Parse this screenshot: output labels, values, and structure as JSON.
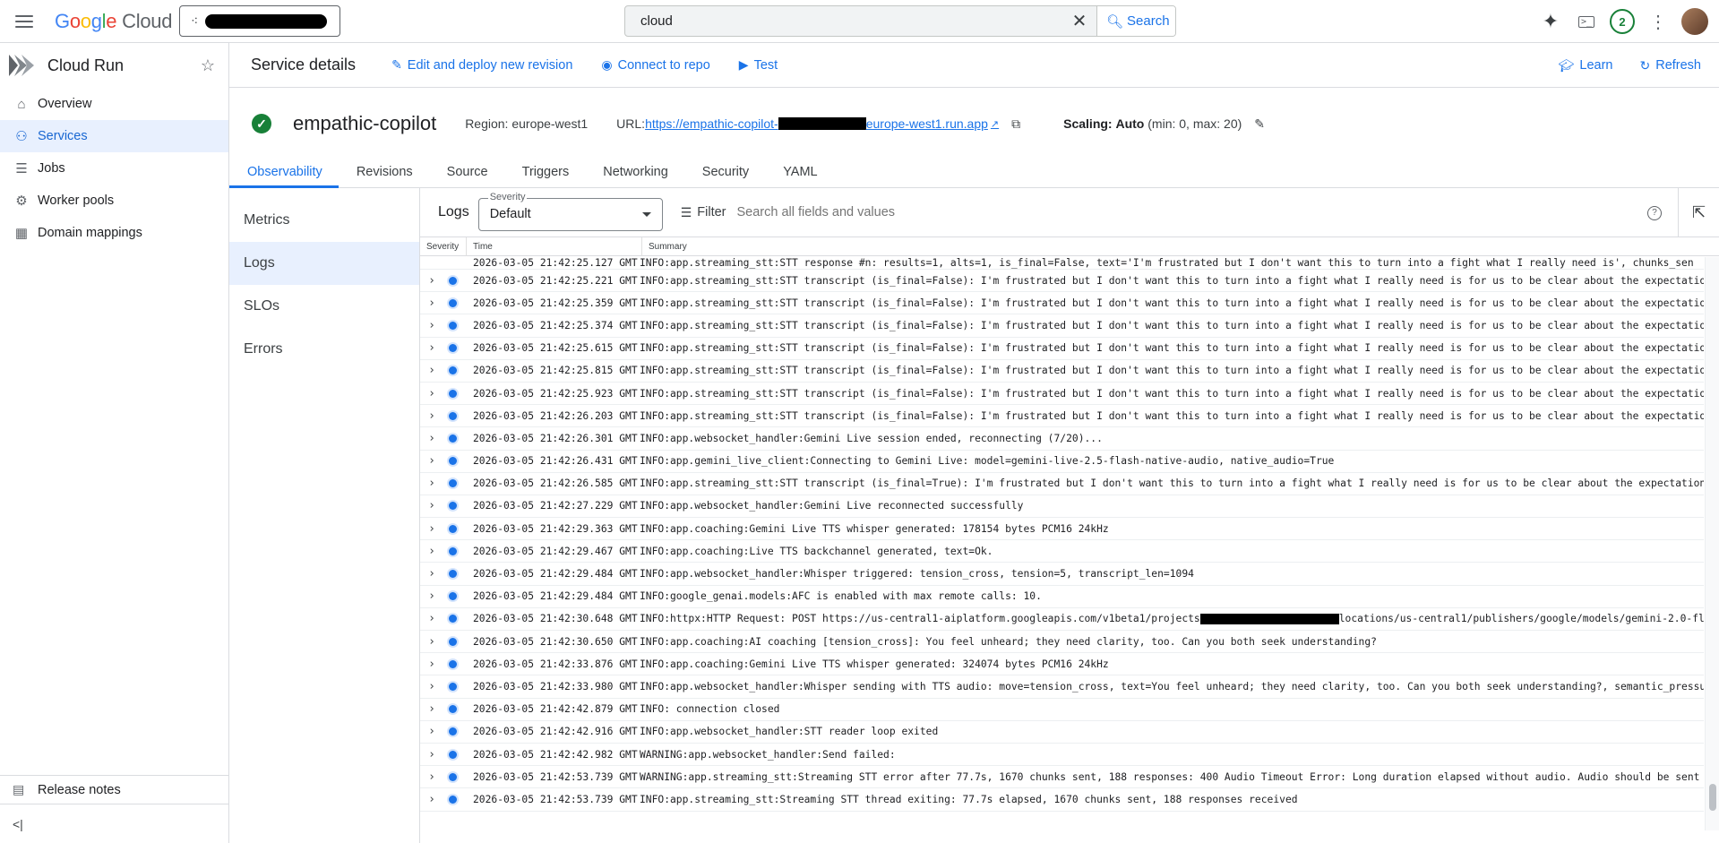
{
  "topbar": {
    "logo_google": "Google",
    "logo_cloud": "Cloud",
    "search_value": "cloud",
    "search_button": "Search",
    "notification_count": "2"
  },
  "nav": {
    "product": "Cloud Run",
    "items": [
      {
        "label": "Overview",
        "icon": "home-icon"
      },
      {
        "label": "Services",
        "icon": "services-icon"
      },
      {
        "label": "Jobs",
        "icon": "list-icon"
      },
      {
        "label": "Worker pools",
        "icon": "worker-pools-icon"
      },
      {
        "label": "Domain mappings",
        "icon": "domain-icon"
      }
    ],
    "active": "Services",
    "release_notes": "Release notes",
    "collapse": "<|"
  },
  "header": {
    "title": "Service details",
    "edit_deploy": "Edit and deploy new revision",
    "connect_repo": "Connect to repo",
    "test": "Test",
    "learn": "Learn",
    "refresh": "Refresh"
  },
  "service": {
    "name": "empathic-copilot",
    "region": "Region: europe-west1",
    "url_label": "URL:",
    "url_prefix": "https://empathic-copilot-",
    "url_suffix": "europe-west1.run.app",
    "scaling_label": "Scaling:",
    "scaling_value": "Auto",
    "scaling_detail": "(min: 0, max: 20)"
  },
  "tabs": [
    "Observability",
    "Revisions",
    "Source",
    "Triggers",
    "Networking",
    "Security",
    "YAML"
  ],
  "subnav": [
    "Metrics",
    "Logs",
    "SLOs",
    "Errors"
  ],
  "logs": {
    "title": "Logs",
    "severity_label": "Severity",
    "severity_value": "Default",
    "filter_label": "Filter",
    "filter_placeholder": "Search all fields and values",
    "columns": [
      "Severity",
      "Time",
      "Summary"
    ],
    "partial_row": {
      "time": "2026-03-05 21:42:25.127 GMT",
      "message": "INFO:app.streaming_stt:STT response #n: results=1, alts=1, is_final=False, text='I'm frustrated but I don't want this to turn into a fight what I really need is', chunks_sen"
    },
    "rows": [
      {
        "time": "2026-03-05 21:42:25.221 GMT",
        "message": "INFO:app.streaming_stt:STT transcript (is_final=False): I'm frustrated but I don't want this to turn into a fight what I really need is for us to be clear about the expectation"
      },
      {
        "time": "2026-03-05 21:42:25.359 GMT",
        "message": "INFO:app.streaming_stt:STT transcript (is_final=False): I'm frustrated but I don't want this to turn into a fight what I really need is for us to be clear about the expectation"
      },
      {
        "time": "2026-03-05 21:42:25.374 GMT",
        "message": "INFO:app.streaming_stt:STT transcript (is_final=False): I'm frustrated but I don't want this to turn into a fight what I really need is for us to be clear about the expectation"
      },
      {
        "time": "2026-03-05 21:42:25.615 GMT",
        "message": "INFO:app.streaming_stt:STT transcript (is_final=False): I'm frustrated but I don't want this to turn into a fight what I really need is for us to be clear about the expectation"
      },
      {
        "time": "2026-03-05 21:42:25.815 GMT",
        "message": "INFO:app.streaming_stt:STT transcript (is_final=False): I'm frustrated but I don't want this to turn into a fight what I really need is for us to be clear about the expectation"
      },
      {
        "time": "2026-03-05 21:42:25.923 GMT",
        "message": "INFO:app.streaming_stt:STT transcript (is_final=False): I'm frustrated but I don't want this to turn into a fight what I really need is for us to be clear about the expectation"
      },
      {
        "time": "2026-03-05 21:42:26.203 GMT",
        "message": "INFO:app.streaming_stt:STT transcript (is_final=False): I'm frustrated but I don't want this to turn into a fight what I really need is for us to be clear about the expectation"
      },
      {
        "time": "2026-03-05 21:42:26.301 GMT",
        "message": "INFO:app.websocket_handler:Gemini Live session ended, reconnecting (7/20)..."
      },
      {
        "time": "2026-03-05 21:42:26.431 GMT",
        "message": "INFO:app.gemini_live_client:Connecting to Gemini Live: model=gemini-live-2.5-flash-native-audio, native_audio=True"
      },
      {
        "time": "2026-03-05 21:42:26.585 GMT",
        "message": "INFO:app.streaming_stt:STT transcript (is_final=True): I'm frustrated but I don't want this to turn into a fight what I really need is for us to be clear about the expectation"
      },
      {
        "time": "2026-03-05 21:42:27.229 GMT",
        "message": "INFO:app.websocket_handler:Gemini Live reconnected successfully"
      },
      {
        "time": "2026-03-05 21:42:29.363 GMT",
        "message": "INFO:app.coaching:Gemini Live TTS whisper generated: 178154 bytes PCM16 24kHz"
      },
      {
        "time": "2026-03-05 21:42:29.467 GMT",
        "message": "INFO:app.coaching:Live TTS backchannel generated, text=Ok."
      },
      {
        "time": "2026-03-05 21:42:29.484 GMT",
        "message": "INFO:app.websocket_handler:Whisper triggered: tension_cross, tension=5, transcript_len=1094"
      },
      {
        "time": "2026-03-05 21:42:29.484 GMT",
        "message": "INFO:google_genai.models:AFC is enabled with max remote calls: 10."
      },
      {
        "time": "2026-03-05 21:42:30.648 GMT",
        "message": "INFO:httpx:HTTP Request: POST https://us-central1-aiplatform.googleapis.com/v1beta1/projects",
        "message_after": "locations/us-central1/publishers/google/models/gemini-2.0-fl…",
        "redacted": true
      },
      {
        "time": "2026-03-05 21:42:30.650 GMT",
        "message": "INFO:app.coaching:AI coaching [tension_cross]: You feel unheard; they need clarity, too. Can you both seek understanding?"
      },
      {
        "time": "2026-03-05 21:42:33.876 GMT",
        "message": "INFO:app.coaching:Gemini Live TTS whisper generated: 324074 bytes PCM16 24kHz"
      },
      {
        "time": "2026-03-05 21:42:33.980 GMT",
        "message": "INFO:app.websocket_handler:Whisper sending with TTS audio: move=tension_cross, text=You feel unheard; they need clarity, too. Can you both seek understanding?, semantic_pressur…"
      },
      {
        "time": "2026-03-05 21:42:42.879 GMT",
        "message": "INFO:     connection closed"
      },
      {
        "time": "2026-03-05 21:42:42.916 GMT",
        "message": "INFO:app.websocket_handler:STT reader loop exited"
      },
      {
        "time": "2026-03-05 21:42:42.982 GMT",
        "message": "WARNING:app.websocket_handler:Send failed:"
      },
      {
        "time": "2026-03-05 21:42:53.739 GMT",
        "message": "WARNING:app.streaming_stt:Streaming STT error after 77.7s, 1670 chunks sent, 188 responses: 400 Audio Timeout Error: Long duration elapsed without audio. Audio should be sent c…"
      },
      {
        "time": "2026-03-05 21:42:53.739 GMT",
        "message": "INFO:app.streaming_stt:Streaming STT thread exiting: 77.7s elapsed, 1670 chunks sent, 188 responses received"
      }
    ]
  }
}
